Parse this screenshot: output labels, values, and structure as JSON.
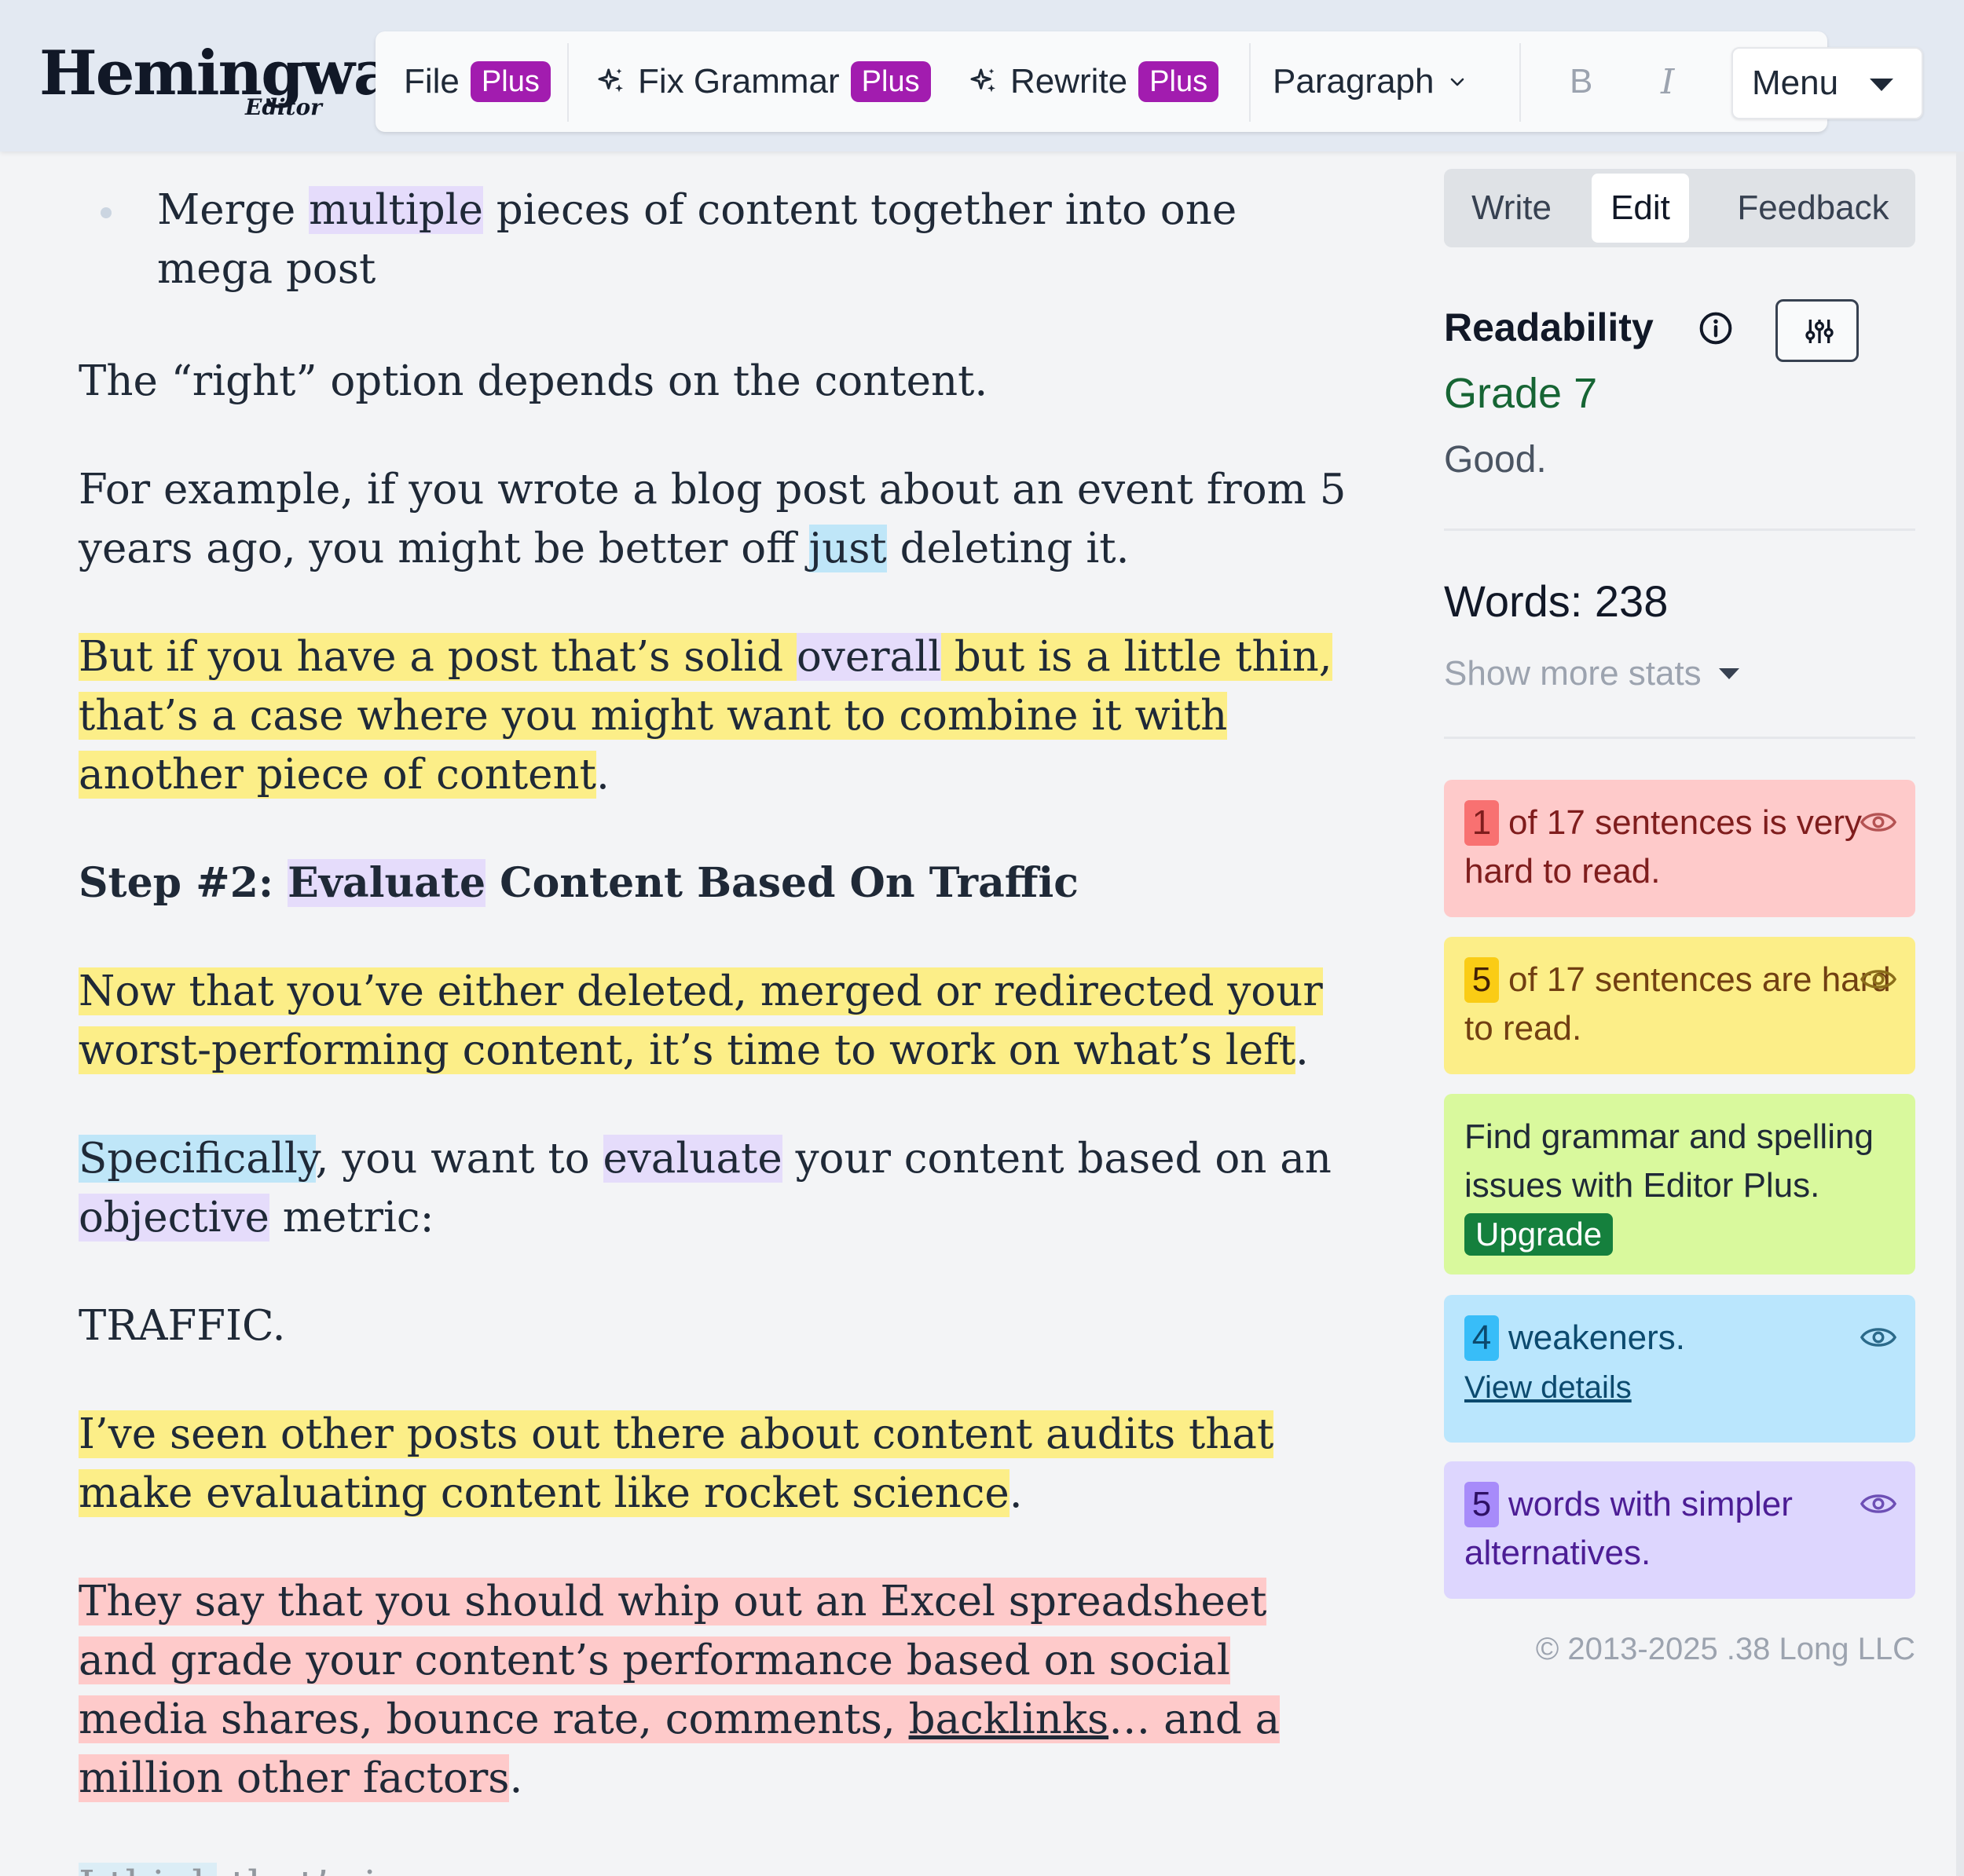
{
  "app": {
    "logo_main": "Hemingway",
    "logo_sub": "Editor"
  },
  "toolbar": {
    "file": "File",
    "fix_grammar": "Fix Grammar",
    "rewrite": "Rewrite",
    "plus_badge": "Plus",
    "paragraph": "Paragraph",
    "bold": "B",
    "italic": "I",
    "menu": "Menu"
  },
  "editor": {
    "bullet": {
      "t1": "Merge ",
      "t2": "multiple",
      "t3": " pieces of content together into one mega post"
    },
    "p1": "The “right” option depends on the content.",
    "p2": {
      "t1": "For example, if you wrote a blog post about an event from 5 years ago, you might be better off ",
      "t2": "just",
      "t3": " deleting it."
    },
    "p3": {
      "t1": "But if you have a post that’s solid ",
      "t2": "overall",
      "t3": " but is a little thin, that’s a case where you might want to combine it with another piece of content",
      "t4": "."
    },
    "h1": {
      "t1": "Step #2: ",
      "t2": "Evaluate",
      "t3": " Content Based On Traffic"
    },
    "p4": {
      "t1": "Now that you’ve either deleted, merged or redirected your worst-performing content, it’s time to work on what’s left",
      "t2": "."
    },
    "p5": {
      "t1": "Specifically",
      "t2": ", you want to ",
      "t3": "evaluate",
      "t4": " your content based on an ",
      "t5": "objective",
      "t6": " metric:"
    },
    "p6": "TRAFFIC.",
    "p7": {
      "t1": "I’ve seen other posts out there about content audits that make evaluating content like rocket science",
      "t2": "."
    },
    "p8": {
      "t1": "They say that you should whip out an Excel spreadsheet and grade your content’s performance based on social media shares, bounce rate, comments, ",
      "t2": "backlinks",
      "t3": "… and a million other factors",
      "t4": "."
    },
    "p9": {
      "t1": "I think",
      "t2": " that’s insane."
    }
  },
  "sidebar": {
    "tabs": [
      "Write",
      "Edit",
      "Feedback"
    ],
    "readability_label": "Readability",
    "grade": "Grade 7",
    "grade_desc": "Good.",
    "words": "Words: 238",
    "show_more": "Show more stats",
    "cards": {
      "very_hard": {
        "count": "1",
        "text": "of 17 sentences is very hard to read."
      },
      "hard": {
        "count": "5",
        "text": "of 17 sentences are hard to read."
      },
      "grammar": {
        "text": "Find grammar and spelling issues with Editor Plus.",
        "button": "Upgrade"
      },
      "weakeners": {
        "count": "4",
        "text": "weakeners.",
        "link": "View details"
      },
      "simpler": {
        "count": "5",
        "text": "words with simpler alternatives."
      }
    },
    "copyright": "© 2013-2025 .38 Long LLC"
  },
  "colors": {
    "plus_badge": "#a21caf",
    "highlight_yellow": "#fcee88",
    "highlight_red": "#fecaca",
    "highlight_purple": "#e5dcfb",
    "highlight_blue": "#bfe6f8",
    "grade_green": "#166534"
  },
  "icons": [
    "sparkle-icon",
    "chevron-down-icon",
    "caret-down-icon",
    "info-icon",
    "sliders-icon",
    "eye-icon"
  ]
}
